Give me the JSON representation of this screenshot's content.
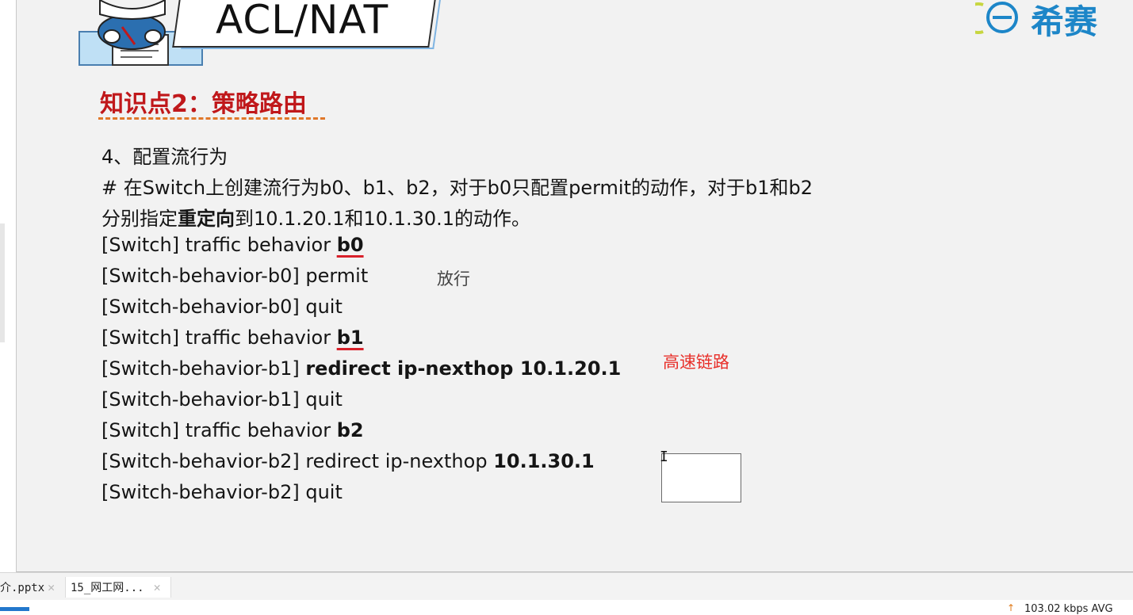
{
  "header": {
    "banner_title": "ACL/NAT",
    "logo_text": "希赛",
    "logo_icon": "e-circle-logo-icon"
  },
  "section": {
    "title": "知识点2：策略路由"
  },
  "content": {
    "step": "4、配置流行为",
    "desc1": "# 在Switch上创建流行为b0、b1、b2，对于b0只配置permit的动作，对于b1和b2",
    "desc2_pre": "分别指定",
    "desc2_bold": "重定向",
    "desc2_post": "到10.1.20.1和10.1.30.1的动作。",
    "cmds": [
      {
        "prefix": "[Switch] traffic behavior ",
        "arg": "b0"
      },
      {
        "prefix": "[Switch-behavior-b0] ",
        "arg": "permit"
      },
      {
        "prefix": "[Switch-behavior-b0] ",
        "arg": "quit"
      },
      {
        "prefix": "[Switch] traffic behavior ",
        "arg": "b1"
      },
      {
        "prefix": "[Switch-behavior-b1] ",
        "arg": "redirect ip-nexthop 10.1.20.1"
      },
      {
        "prefix": "[Switch-behavior-b1] ",
        "arg": "quit"
      },
      {
        "prefix": "[Switch] traffic behavior ",
        "arg": "b2"
      },
      {
        "prefix": "[Switch-behavior-b2] ",
        "arg": "redirect ip-nexthop ",
        "arg_bold": "10.1.30.1"
      },
      {
        "prefix": "[Switch-behavior-b2] ",
        "arg": "quit"
      }
    ]
  },
  "annotations": {
    "permit_note": "放行",
    "redirect_note": "高速链路"
  },
  "tabs": [
    {
      "label": "简介.pptx"
    },
    {
      "label": "15_网工网..."
    }
  ],
  "status": {
    "network": "103.02 kbps  AVG"
  },
  "colors": {
    "accent_red": "#c0181b",
    "note_red": "#e8302a",
    "underline_orange": "#e0782a",
    "logo_blue": "#1d86c8"
  }
}
